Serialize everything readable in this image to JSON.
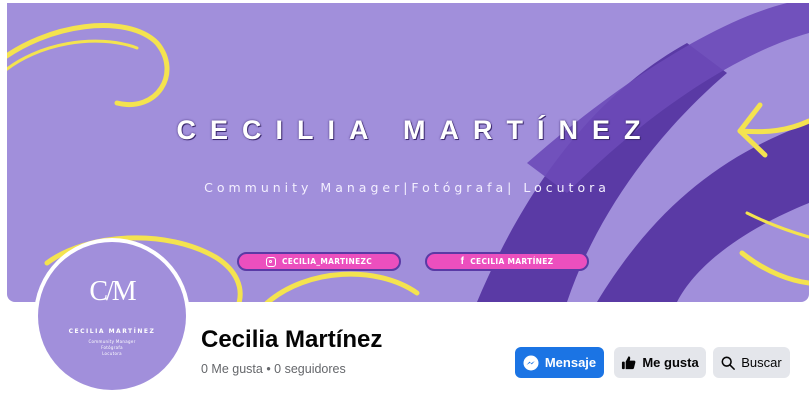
{
  "cover": {
    "title": "CECILIA MARTÍNEZ",
    "subtitle": "Community Manager|Fotógrafa| Locutora",
    "instagram_handle": "CECILIA_MARTINEZC",
    "facebook_handle": "CECILIA MARTÍNEZ",
    "colors": {
      "background": "#a18fdb",
      "accent_yellow": "#f4e34f",
      "stroke_purple": "#5a3aa5",
      "pill_pink": "#ec4fbe"
    }
  },
  "avatar": {
    "monogram": "C/M",
    "name": "CECILIA MARTÍNEZ",
    "lines": [
      "Community Manager",
      "Fotógrafa",
      "Locutora"
    ]
  },
  "profile": {
    "name": "Cecilia Martínez",
    "stats": "0 Me gusta • 0 seguidores"
  },
  "actions": {
    "message_label": "Mensaje",
    "like_label": "Me gusta",
    "search_label": "Buscar"
  }
}
